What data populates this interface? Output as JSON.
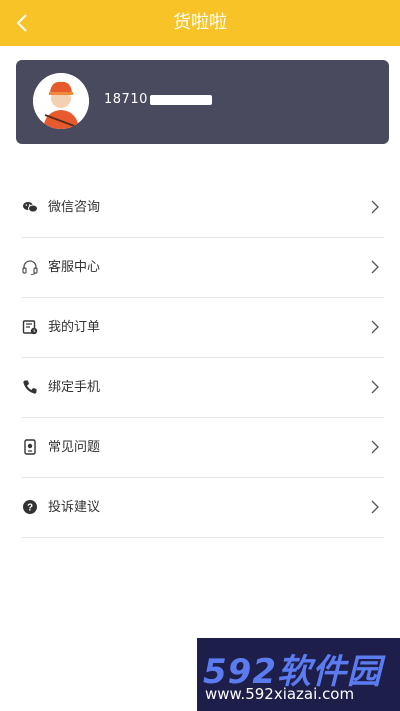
{
  "header": {
    "title": "货啦啦"
  },
  "profile": {
    "phone": "18710"
  },
  "menu": {
    "items": [
      {
        "label": "微信咨询",
        "icon": "wechat-icon"
      },
      {
        "label": "客服中心",
        "icon": "headset-icon"
      },
      {
        "label": "我的订单",
        "icon": "order-icon"
      },
      {
        "label": "绑定手机",
        "icon": "phone-icon"
      },
      {
        "label": "常见问题",
        "icon": "faq-icon"
      },
      {
        "label": "投诉建议",
        "icon": "question-icon"
      }
    ]
  },
  "watermark": {
    "brand": "592软件园",
    "url": "www.592xiazai.com"
  },
  "colors": {
    "accent": "#f7c326",
    "card": "#4a4a5f"
  }
}
